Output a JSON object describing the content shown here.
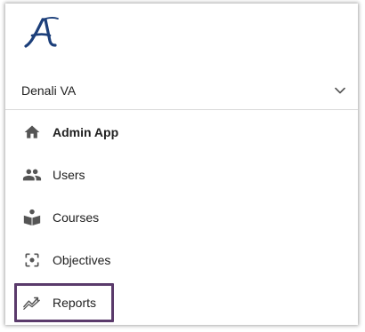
{
  "brand": {
    "logo_letter": "A",
    "logo_color": "#1c3f7a"
  },
  "org_selector": {
    "label": "Denali VA",
    "icon": "chevron-down-icon"
  },
  "nav": {
    "items": [
      {
        "label": "Admin App",
        "icon": "home-icon",
        "bold": true
      },
      {
        "label": "Users",
        "icon": "people-icon"
      },
      {
        "label": "Courses",
        "icon": "book-reader-icon"
      },
      {
        "label": "Objectives",
        "icon": "center-focus-icon"
      },
      {
        "label": "Reports",
        "icon": "trending-icon",
        "highlighted": true
      }
    ]
  },
  "colors": {
    "icon": "#555555",
    "highlight_border": "#5a3a6b",
    "text": "#202020"
  }
}
